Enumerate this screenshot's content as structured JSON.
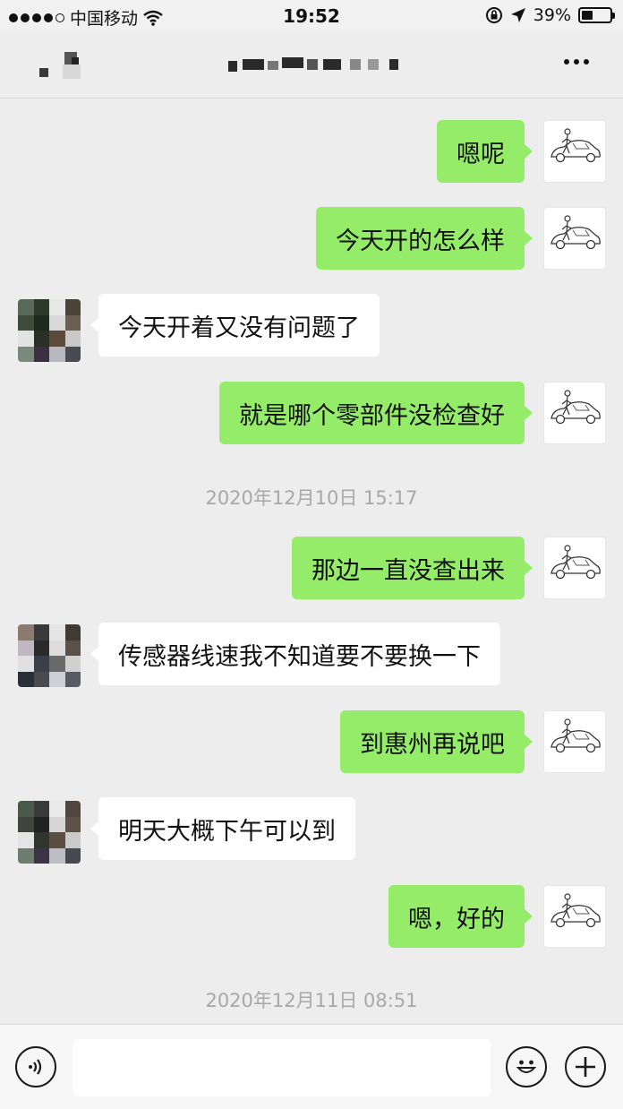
{
  "status_bar": {
    "carrier": "中国移动",
    "time": "19:52",
    "battery": "39%",
    "battery_level": 0.39,
    "icons": [
      "signal-icon",
      "wifi-icon",
      "rotation-lock-icon",
      "location-arrow-icon",
      "battery-icon"
    ]
  },
  "nav": {
    "icons": [
      "back-icon",
      "more-icon"
    ]
  },
  "messages": [
    {
      "side": "me",
      "text": "嗯呢"
    },
    {
      "side": "me",
      "text": "今天开的怎么样"
    },
    {
      "side": "other",
      "text": "今天开着又没有问题了"
    },
    {
      "side": "me",
      "text": "就是哪个零部件没检查好"
    },
    {
      "side": "time",
      "text": "2020年12月10日 15:17"
    },
    {
      "side": "me",
      "text": "那边一直没查出来"
    },
    {
      "side": "other",
      "text": "传感器线速我不知道要不要换一下"
    },
    {
      "side": "me",
      "text": "到惠州再说吧"
    },
    {
      "side": "other",
      "text": "明天大概下午可以到"
    },
    {
      "side": "me",
      "text": "嗯，好的"
    },
    {
      "side": "time",
      "text": "2020年12月11日 08:51"
    }
  ],
  "colors": {
    "background": "#ededed",
    "my_bubble": "#95ec69",
    "other_bubble": "#ffffff",
    "timestamp": "#a8a8a8"
  },
  "input_bar": {
    "value": "",
    "icons": [
      "voice-icon",
      "emoji-icon",
      "plus-icon"
    ]
  }
}
